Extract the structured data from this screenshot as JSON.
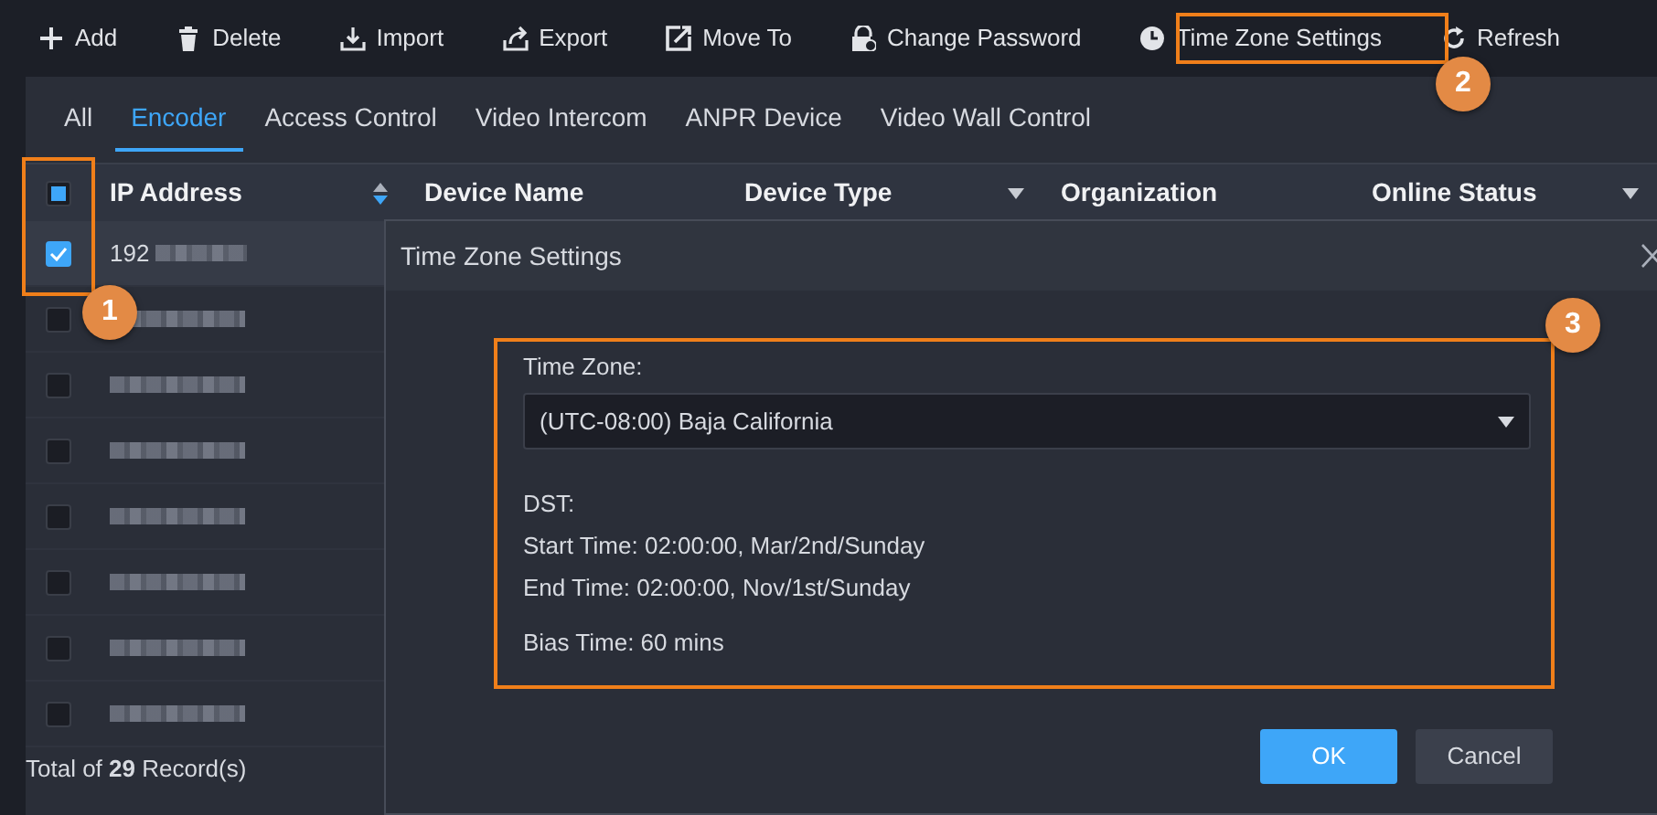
{
  "toolbar": [
    {
      "label": "Add"
    },
    {
      "label": "Delete"
    },
    {
      "label": "Import"
    },
    {
      "label": "Export"
    },
    {
      "label": "Move To"
    },
    {
      "label": "Change Password"
    },
    {
      "label": "Time Zone Settings"
    },
    {
      "label": "Refresh"
    }
  ],
  "tabs": [
    {
      "label": "All",
      "selected": false
    },
    {
      "label": "Encoder",
      "selected": true
    },
    {
      "label": "Access Control",
      "selected": false
    },
    {
      "label": "Video Intercom",
      "selected": false
    },
    {
      "label": "ANPR Device",
      "selected": false
    },
    {
      "label": "Video Wall Control",
      "selected": false
    }
  ],
  "table": {
    "select_all": {
      "checked": false,
      "partial": true
    },
    "columns": [
      {
        "label": "IP Address",
        "kind": "sort"
      },
      {
        "label": "Device Name",
        "kind": "plain"
      },
      {
        "label": "Device Type",
        "kind": "filter"
      },
      {
        "label": "Organization",
        "kind": "plain"
      },
      {
        "label": "Online Status",
        "kind": "filter"
      }
    ],
    "rows": [
      {
        "ip": "192",
        "checked": true,
        "selected": true
      },
      {
        "checked": false,
        "selected": false
      },
      {
        "checked": false,
        "selected": false
      },
      {
        "checked": false,
        "selected": false
      },
      {
        "checked": false,
        "selected": false
      },
      {
        "checked": false,
        "selected": false
      },
      {
        "checked": false,
        "selected": false
      },
      {
        "checked": false,
        "selected": false
      }
    ]
  },
  "footer": "Total of **29** Record(s)",
  "dialog": {
    "title": "Time Zone Settings",
    "time_zone_label": "Time Zone:",
    "time_zone": "(UTC-08:00) Baja California",
    "dst_label": "DST:",
    "start_time": "Start Time: 02:00:00, Mar/2nd/Sunday",
    "end_time": "End Time: 02:00:00, Nov/1st/Sunday",
    "bias_time": "Bias Time: 60 mins",
    "buttons": [
      {
        "label": "OK",
        "kind": "primary"
      },
      {
        "label": "Cancel",
        "kind": "secondary"
      }
    ]
  },
  "callouts": [
    {
      "number": "1"
    },
    {
      "number": "2"
    },
    {
      "number": "3"
    }
  ]
}
